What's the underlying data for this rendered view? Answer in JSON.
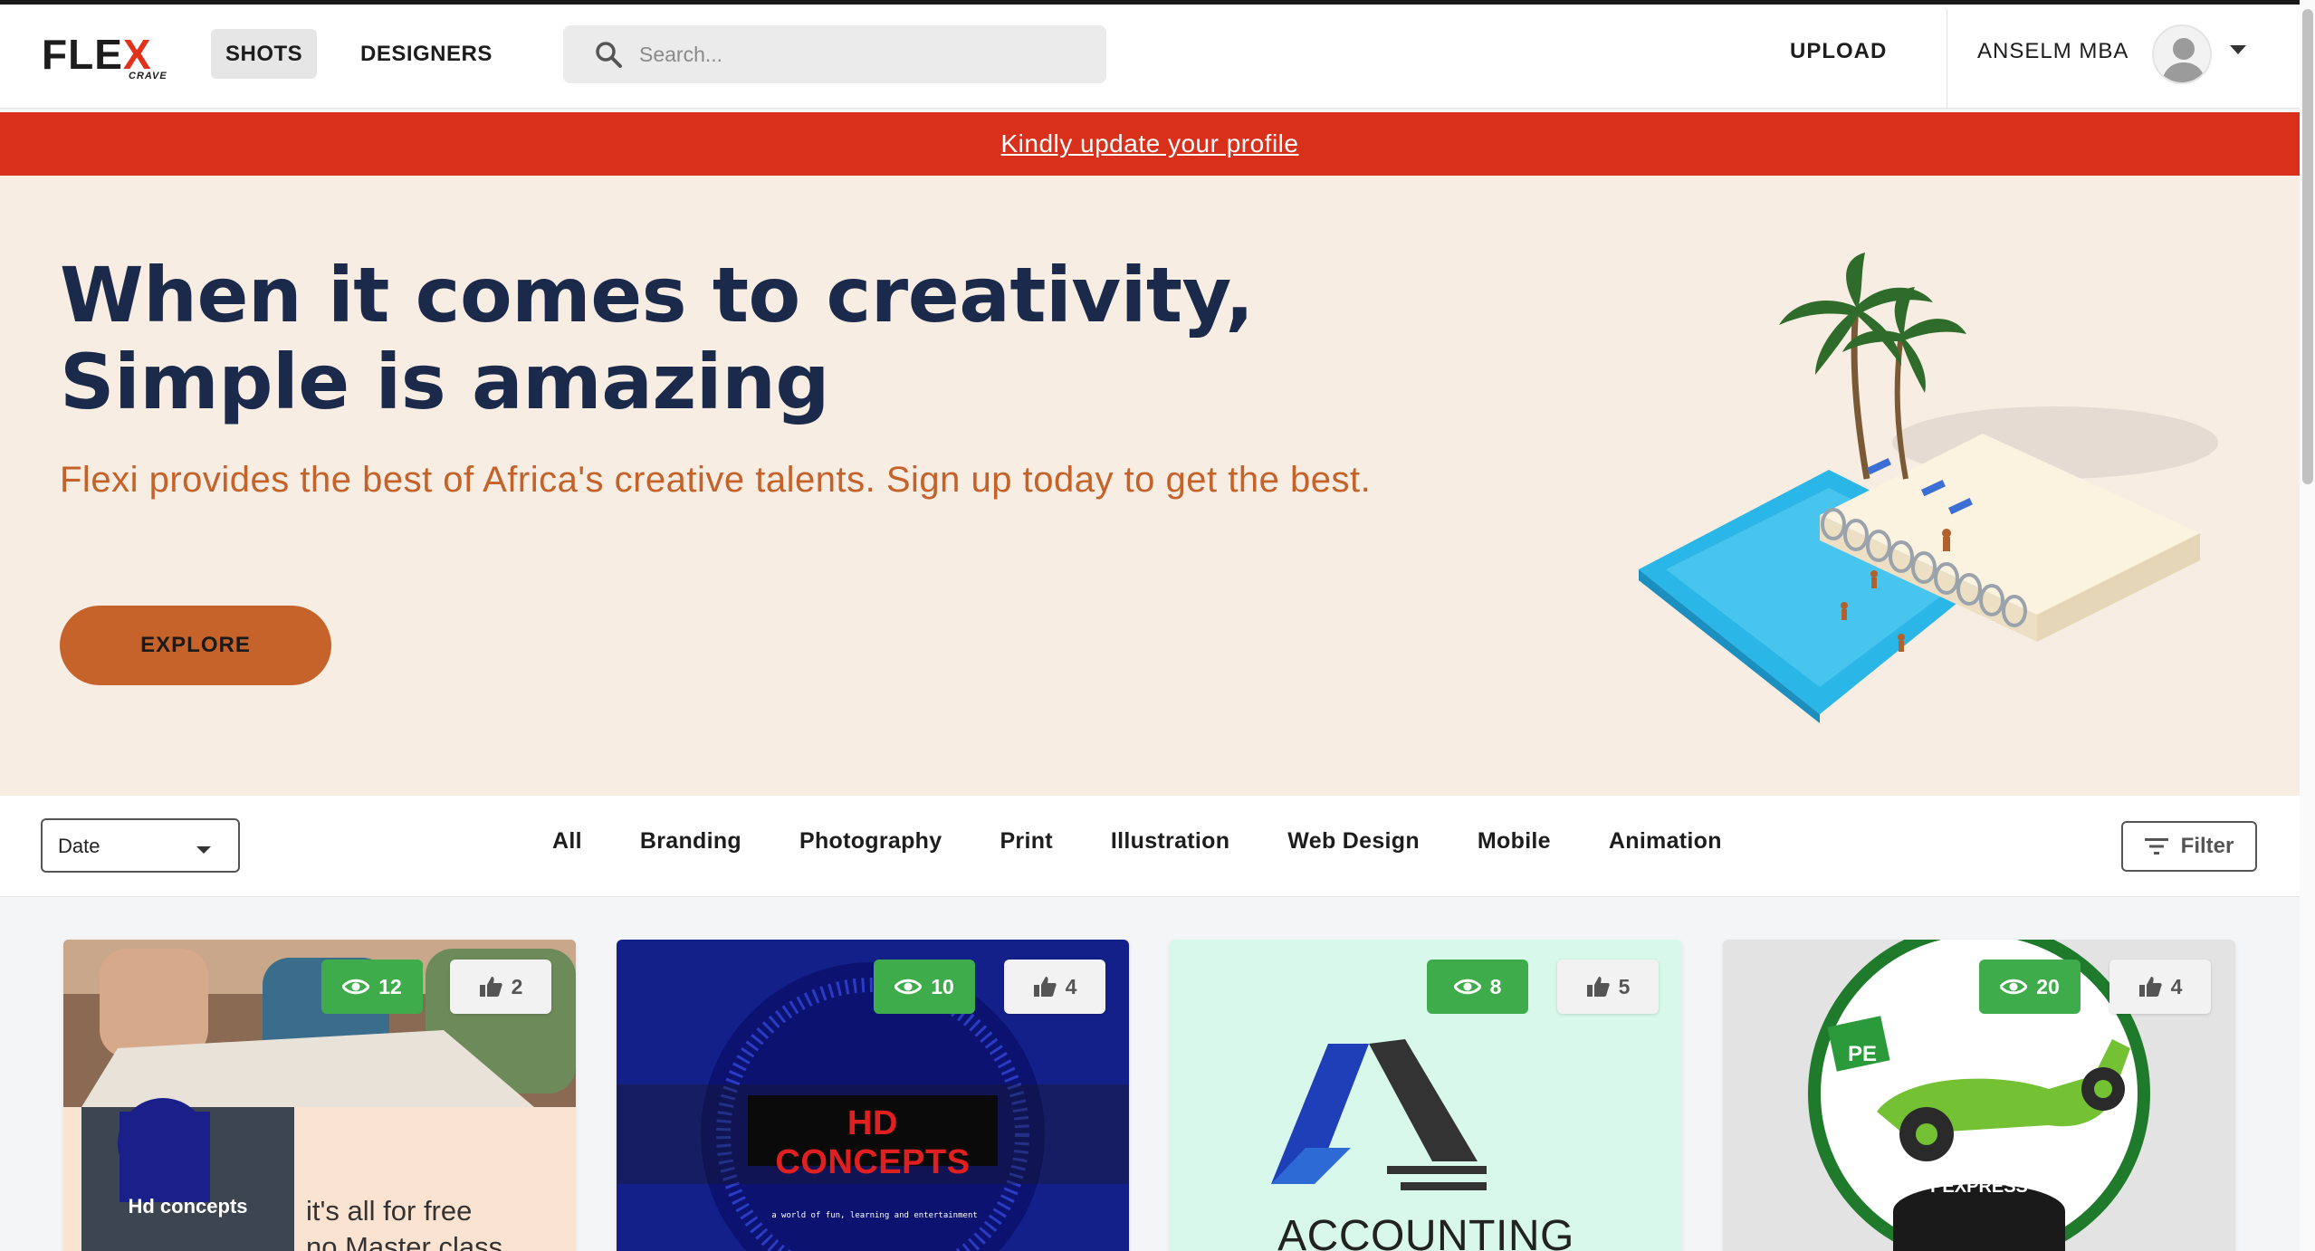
{
  "brand": {
    "name": "FLEX",
    "x_letter": "X",
    "sub": "CRAVE"
  },
  "nav": {
    "shots": "SHOTS",
    "designers": "DESIGNERS"
  },
  "search": {
    "placeholder": "Search..."
  },
  "header": {
    "upload": "UPLOAD",
    "username": "ANSELM MBA"
  },
  "notice": {
    "text": "Kindly update your profile"
  },
  "hero": {
    "title_line1": "When it comes to creativity,",
    "title_line2": "Simple is amazing",
    "subtitle": "Flexi provides the best of Africa's creative talents. Sign up today to get the best.",
    "cta": "EXPLORE"
  },
  "filters": {
    "sort": "Date",
    "categories": [
      "All",
      "Branding",
      "Photography",
      "Print",
      "Illustration",
      "Web Design",
      "Mobile",
      "Animation"
    ],
    "filter_button": "Filter"
  },
  "cards": [
    {
      "views": "12",
      "likes": "2",
      "caption_brand": "Hd concepts",
      "caption_text_1": "it's all for free",
      "caption_text_2": "no Master class"
    },
    {
      "views": "10",
      "likes": "4",
      "title": "HD CONCEPTS",
      "tagline": "a world of fun, learning and entertainment"
    },
    {
      "views": "8",
      "likes": "5",
      "title": "ACCOUNTING SOFTWARES"
    },
    {
      "views": "20",
      "likes": "4",
      "initials": "PE",
      "title": "PEXPRESS"
    }
  ],
  "colors": {
    "accent_red": "#d9301c",
    "hero_bg": "#f8ede3",
    "hero_title": "#1b2a4a",
    "hero_subtitle": "#c4622a",
    "cta": "#c5632b",
    "views_badge": "#3fac4b"
  }
}
